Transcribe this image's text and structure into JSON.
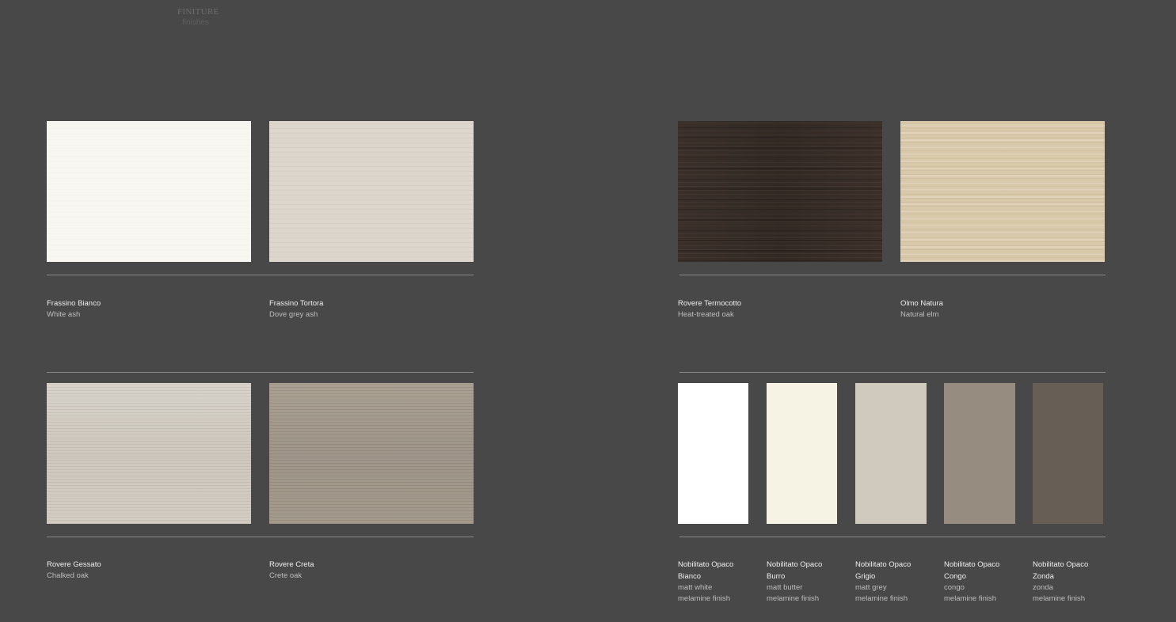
{
  "header": {
    "title": "FINITURE",
    "subtitle": "finishes"
  },
  "finishes": [
    {
      "name": "Frassino Bianco",
      "sub": "White ash",
      "color": "#f8f6f1"
    },
    {
      "name": "Frassino Tortora",
      "sub": "Dove grey ash",
      "color": "#dcd6cc"
    },
    {
      "name": "Rovere Termocotto",
      "sub": "Heat-treated oak",
      "color": "#372c26"
    },
    {
      "name": "Olmo Natura",
      "sub": "Natural elm",
      "color": "#d9c9ab"
    },
    {
      "name": "Rovere Gessato",
      "sub": "Chalked oak",
      "color": "#d2ccc2"
    },
    {
      "name": "Rovere Creta",
      "sub": "Crete oak",
      "color": "#a39a8c"
    }
  ],
  "melamine": [
    {
      "name1": "Nobilitato Opaco",
      "name2": "Bianco",
      "sub1": "matt white",
      "sub2": "melamine finish",
      "color": "#ffffff"
    },
    {
      "name1": "Nobilitato Opaco",
      "name2": "Burro",
      "sub1": "matt butter",
      "sub2": "melamine finish",
      "color": "#f6f3e4"
    },
    {
      "name1": "Nobilitato Opaco",
      "name2": "Grigio",
      "sub1": "matt grey",
      "sub2": "melamine finish",
      "color": "#d0c9bd"
    },
    {
      "name1": "Nobilitato Opaco",
      "name2": "Congo",
      "sub1": "congo",
      "sub2": "melamine finish",
      "color": "#978c80"
    },
    {
      "name1": "Nobilitato Opaco",
      "name2": "Zonda",
      "sub1": "zonda",
      "sub2": "melamine finish",
      "color": "#675e56"
    }
  ]
}
